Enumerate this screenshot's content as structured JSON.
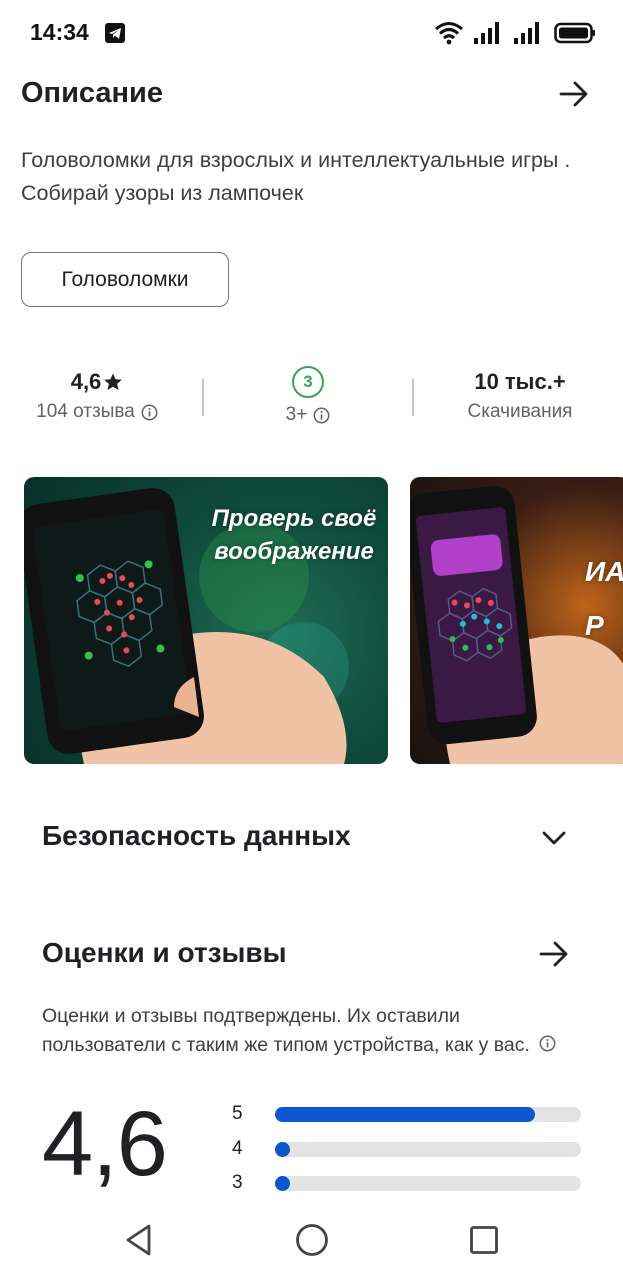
{
  "status_bar": {
    "time": "14:34",
    "icons": [
      "telegram-icon",
      "wifi-icon",
      "signal-icon",
      "signal-icon",
      "battery-icon"
    ]
  },
  "description": {
    "title": "Описание",
    "text": "Головоломки для взрослых и интеллектуальные игры . Собирай узоры из лампочек",
    "tag": "Головоломки"
  },
  "stats": {
    "rating_value": "4,6",
    "rating_label": "104 отзыва",
    "age_badge": "3",
    "age_label": "3+",
    "downloads_value": "10 тыс.+",
    "downloads_label": "Скачивания"
  },
  "screenshots": [
    {
      "promo_text": "Проверь своё воображение"
    },
    {
      "promo_text": "ИА Р"
    }
  ],
  "data_safety": {
    "title": "Безопасность данных"
  },
  "ratings": {
    "title": "Оценки и отзывы",
    "note": "Оценки и отзывы подтверждены. Их оставили пользователи с таким же типом устройства, как у вас.",
    "average": "4,6",
    "bars": [
      {
        "stars": "5",
        "fraction": 0.85
      },
      {
        "stars": "4",
        "fraction": 0.04
      },
      {
        "stars": "3",
        "fraction": 0.04
      }
    ]
  },
  "colors": {
    "accent": "#0b57d0",
    "age_green": "#34a853",
    "text_primary": "#202124",
    "text_secondary": "#5f6368"
  }
}
